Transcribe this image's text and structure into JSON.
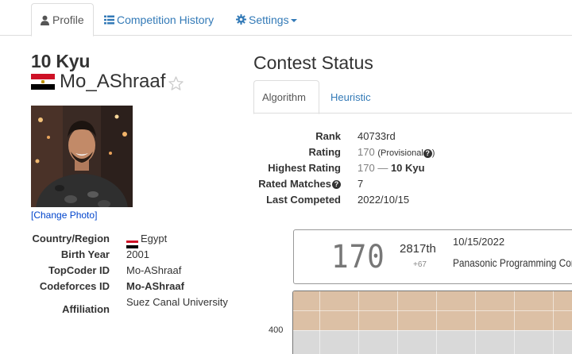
{
  "nav": {
    "tabs": [
      {
        "label": "Profile",
        "icon": "user-icon",
        "active": true
      },
      {
        "label": "Competition History",
        "icon": "list-icon",
        "active": false
      },
      {
        "label": "Settings",
        "icon": "gear-icon",
        "active": false
      }
    ]
  },
  "profile": {
    "rank": "10 Kyu",
    "username": "Mo_AShraaf",
    "change_photo": "[Change Photo]",
    "fields": {
      "country_label": "Country/Region",
      "country_value": "Egypt",
      "birth_label": "Birth Year",
      "birth_value": "2001",
      "topcoder_label": "TopCoder ID",
      "topcoder_value": "Mo-AShraaf",
      "codeforces_label": "Codeforces ID",
      "codeforces_value": "Mo-AShraaf",
      "affiliation_label": "Affiliation",
      "affiliation_value": "Suez Canal University"
    }
  },
  "contest": {
    "title": "Contest Status",
    "tabs": [
      "Algorithm",
      "Heuristic"
    ],
    "stats": {
      "rank_label": "Rank",
      "rank_value": "40733rd",
      "rating_label": "Rating",
      "rating_value": "170",
      "rating_note": "(Provisional",
      "rating_note_close": ")",
      "highest_label": "Highest Rating",
      "highest_value": "170",
      "highest_sep": " — ",
      "highest_kyu": "10 Kyu",
      "rated_label": "Rated Matches",
      "rated_value": "7",
      "last_label": "Last Competed",
      "last_value": "2022/10/15"
    },
    "card": {
      "rating": "170",
      "place": "2817th",
      "diff": "+67",
      "date": "10/15/2022",
      "contest_name": "Panasonic Programming Contest"
    },
    "chart": {
      "y_label_400": "400"
    }
  },
  "colors": {
    "link": "#337ab7",
    "teal": "#20a4a4",
    "gray_rating": "#808080",
    "band_brown": "#dcc0a5",
    "band_gray": "#d9d9d9"
  }
}
